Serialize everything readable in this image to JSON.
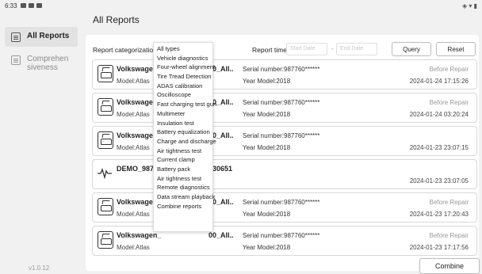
{
  "status_bar": {
    "time": "6:33",
    "right_icons": "◈ ▾ ▮"
  },
  "sidebar": {
    "items": [
      {
        "label": "All Reports"
      },
      {
        "label": "Comprehen\nsiveness"
      }
    ],
    "version": "v1.0.12"
  },
  "page_title": "All Reports",
  "filters": {
    "categorization_label": "Report categorization",
    "report_time_label": "Report time",
    "start_date_placeholder": "Start Date",
    "end_date_placeholder": "End Date",
    "dash": "-",
    "query_label": "Query",
    "reset_label": "Reset"
  },
  "dropdown": {
    "options": [
      "All types",
      "Vehicle diagnostics",
      "Four-wheel alignment",
      "Tire Tread Detection",
      "ADAS calibration",
      "Oscilloscope",
      "Fast charging test gun",
      "Multimeter",
      "Insulation test",
      "Battery equalization",
      "Charge and discharge",
      "Air tightness test",
      "Current clamp",
      "Battery pack",
      "Air tightness test",
      "Remote diagnostics",
      "Data stream playback",
      "Combine reports"
    ]
  },
  "reports": [
    {
      "name": "Volkswagen_",
      "name_tail": "00_All..",
      "model": "Model:Atlas",
      "serial": "Serial number:987760******",
      "year": "Year Model:2018",
      "status": "Before Repair",
      "time": "2024-01-24 17:15:26"
    },
    {
      "name": "Volkswagen_",
      "name_tail": "00_All..",
      "model": "Model:Atlas",
      "serial": "Serial number:987760******",
      "year": "Year Model:2018",
      "status": "Before Repair",
      "time": "2024-01-24 03:20:24"
    },
    {
      "name": "Volkswagen_",
      "name_tail": "00_All..",
      "model": "Model:Atlas",
      "serial": "Serial number:987760******",
      "year": "Year Model:2018",
      "status": "",
      "time": "2024-01-23 23:07:15"
    },
    {
      "name": "DEMO_98776",
      "name_tail": "230651",
      "model": "",
      "serial": "",
      "year": "",
      "status": "",
      "time": "2024-01-23 23:07:05"
    },
    {
      "name": "Volkswagen_",
      "name_tail": "00_All..",
      "model": "Model:Atlas",
      "serial": "Serial number:987760******",
      "year": "Year Model:2018",
      "status": "Before Repair",
      "time": "2024-01-23 17:20:43"
    },
    {
      "name": "Volkswagen_",
      "name_tail": "00_All..",
      "model": "Model:Atlas",
      "serial": "Serial number:987760******",
      "year": "Year Model:2018",
      "status": "Before Repair",
      "time": "2024-01-23 17:17:56"
    }
  ],
  "combine_label": "Combine"
}
